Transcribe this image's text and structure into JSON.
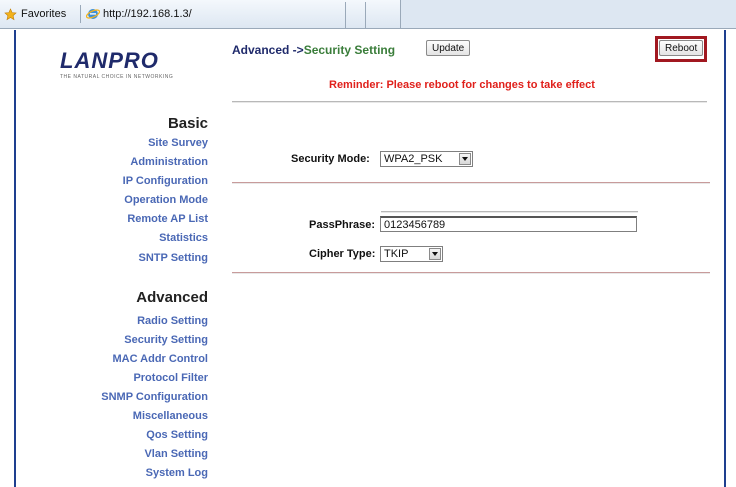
{
  "browser": {
    "favorites_label": "Favorites",
    "url": "http://192.168.1.3/"
  },
  "logo": {
    "brand": "LANPRO",
    "tagline": "THE NATURAL CHOICE IN NETWORKING"
  },
  "menu": {
    "basic_heading": "Basic",
    "basic_items": [
      "Site Survey",
      "Administration",
      "IP Configuration",
      "Operation Mode",
      "Remote AP List",
      "Statistics",
      "SNTP Setting"
    ],
    "advanced_heading": "Advanced",
    "advanced_items": [
      "Radio Setting",
      "Security Setting",
      "MAC Addr Control",
      "Protocol Filter",
      "SNMP Configuration",
      "Miscellaneous",
      "Qos Setting",
      "Vlan Setting",
      "System Log"
    ]
  },
  "header": {
    "breadcrumb_prefix": "Advanced ->",
    "breadcrumb_current": "Security Setting",
    "update_label": "Update",
    "reboot_label": "Reboot",
    "reminder": "Reminder: Please reboot for changes to take effect"
  },
  "form": {
    "security_mode_label": "Security Mode:",
    "security_mode_value": "WPA2_PSK",
    "passphrase_label": "PassPhrase:",
    "passphrase_value": "0123456789",
    "cipher_type_label": "Cipher Type:",
    "cipher_type_value": "TKIP"
  },
  "colors": {
    "link": "#4a68b5",
    "reminder": "#e0201b",
    "highlight_box": "#a11820",
    "frame_border": "#1e3f8f"
  }
}
